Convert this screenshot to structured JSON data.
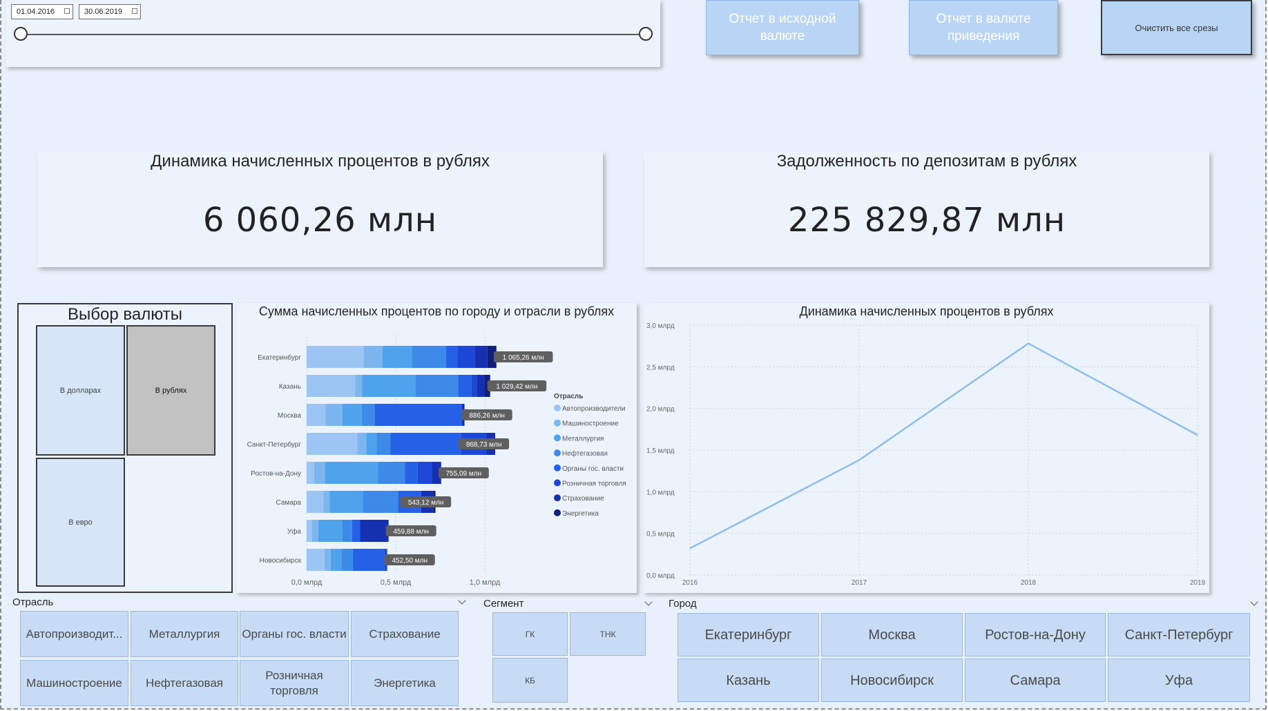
{
  "date_slicer": {
    "start": "01.04.2016",
    "end": "30.06.2019"
  },
  "top_buttons": {
    "original_currency": "Отчет в исходной валюте",
    "converted_currency": "Отчет в валюте приведения",
    "clear_filters": "Очистить все срезы"
  },
  "kpis": [
    {
      "title": "Динамика начисленных процентов в рублях",
      "value": "6 060,26 млн"
    },
    {
      "title": "Задолженность по депозитам в рублях",
      "value": "225 829,87 млн"
    }
  ],
  "currency_selector": {
    "title": "Выбор валюты",
    "options": [
      "В долларах",
      "В рублях",
      "В евро"
    ],
    "selected": "В рублях"
  },
  "chart_data": [
    {
      "type": "bar",
      "orientation": "horizontal",
      "stacked": true,
      "title": "Сумма начисленных процентов по городу и отрасли в рублях",
      "legend_title": "Отрасль",
      "legend_position": "right",
      "categories": [
        "Екатеринбург",
        "Казань",
        "Москва",
        "Санкт-Петербург",
        "Ростов-на-Дону",
        "Самара",
        "Уфа",
        "Новосибирск"
      ],
      "series": [
        {
          "name": "Автопроизводители",
          "color": "#9cc5f3",
          "values": [
            320,
            272,
            105,
            285,
            42,
            95,
            30,
            100
          ]
        },
        {
          "name": "Машиностроение",
          "color": "#7db5ef",
          "values": [
            105,
            40,
            95,
            50,
            60,
            35,
            35,
            35
          ]
        },
        {
          "name": "Металлургия",
          "color": "#4fa3ec",
          "values": [
            168,
            298,
            109,
            58,
            299,
            185,
            135,
            60
          ]
        },
        {
          "name": "Нефтегазовая",
          "color": "#3d8ae8",
          "values": [
            190,
            240,
            72,
            78,
            150,
            198,
            55,
            65
          ]
        },
        {
          "name": "Органы гос. власти",
          "color": "#2461e6",
          "values": [
            64,
            75,
            490,
            397,
            72,
            130,
            44,
            177
          ]
        },
        {
          "name": "Розничная торговля",
          "color": "#1d47d6",
          "values": [
            96,
            30,
            0,
            140,
            80,
            0,
            0,
            15
          ]
        },
        {
          "name": "Страхование",
          "color": "#1530b0",
          "values": [
            72,
            45,
            15,
            50,
            52,
            70,
            161,
            0
          ]
        },
        {
          "name": "Энергетика",
          "color": "#0f1f7a",
          "values": [
            50,
            30,
            0,
            0,
            0,
            10,
            0,
            0
          ]
        }
      ],
      "totals": [
        1065.26,
        1029.42,
        886.26,
        868.73,
        755.09,
        543.12,
        459.88,
        452.5
      ],
      "data_labels": [
        "1 065,26 млн",
        "1 029,42 млн",
        "886,26 млн",
        "868,73 млн",
        "755,09 млн",
        "543,12 млн",
        "459,88 млн",
        "452,50 млн"
      ],
      "xlim": [
        0,
        1.2
      ],
      "x_ticks": [
        "0,0 млрд",
        "0,5 млрд",
        "1,0 млрд"
      ]
    },
    {
      "type": "line",
      "title": "Динамика начисленных процентов в рублях",
      "x": [
        "2016",
        "2017",
        "2018",
        "2019"
      ],
      "series": [
        {
          "color": "#8dbdec",
          "values": [
            0.32,
            1.38,
            2.78,
            1.68
          ]
        }
      ],
      "ylim": [
        0,
        3.0
      ],
      "y_ticks": [
        "0,0 млрд",
        "0,5 млрд",
        "1,0 млрд",
        "1,5 млрд",
        "2,0 млрд",
        "2,5 млрд",
        "3,0 млрд"
      ],
      "grid": true
    }
  ],
  "filters": {
    "industry": {
      "header": "Отрасль",
      "items": [
        "Автопроизводит...",
        "Металлургия",
        "Органы гос. власти",
        "Страхование",
        "Машиностроение",
        "Нефтегазовая",
        "Розничная торговля",
        "Энергетика"
      ]
    },
    "segment": {
      "header": "Сегмент",
      "items": [
        "ГК",
        "ТНК",
        "КБ"
      ]
    },
    "city": {
      "header": "Город",
      "items": [
        "Екатеринбург",
        "Москва",
        "Ростов-на-Дону",
        "Санкт-Петербург",
        "Казань",
        "Новосибирск",
        "Самара",
        "Уфа"
      ]
    }
  }
}
